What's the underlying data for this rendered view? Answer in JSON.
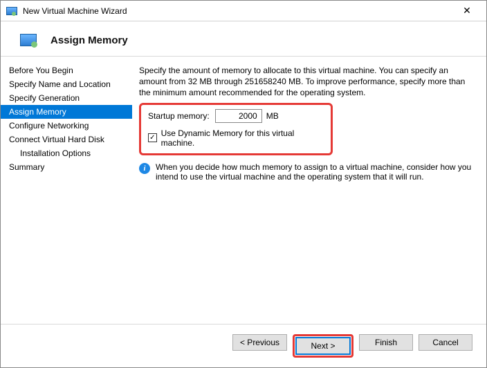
{
  "window": {
    "title": "New Virtual Machine Wizard"
  },
  "header": {
    "title": "Assign Memory"
  },
  "sidebar": {
    "items": [
      {
        "label": "Before You Begin",
        "selected": false,
        "indent": false
      },
      {
        "label": "Specify Name and Location",
        "selected": false,
        "indent": false
      },
      {
        "label": "Specify Generation",
        "selected": false,
        "indent": false
      },
      {
        "label": "Assign Memory",
        "selected": true,
        "indent": false
      },
      {
        "label": "Configure Networking",
        "selected": false,
        "indent": false
      },
      {
        "label": "Connect Virtual Hard Disk",
        "selected": false,
        "indent": false
      },
      {
        "label": "Installation Options",
        "selected": false,
        "indent": true
      },
      {
        "label": "Summary",
        "selected": false,
        "indent": false
      }
    ]
  },
  "content": {
    "description": "Specify the amount of memory to allocate to this virtual machine. You can specify an amount from 32 MB through 251658240 MB. To improve performance, specify more than the minimum amount recommended for the operating system.",
    "startup_label": "Startup memory:",
    "startup_value": "2000",
    "startup_unit": "MB",
    "dynamic_label": "Use Dynamic Memory for this virtual machine.",
    "dynamic_checked": true,
    "info_text": "When you decide how much memory to assign to a virtual machine, consider how you intend to use the virtual machine and the operating system that it will run."
  },
  "footer": {
    "previous": "< Previous",
    "next": "Next >",
    "finish": "Finish",
    "cancel": "Cancel"
  }
}
